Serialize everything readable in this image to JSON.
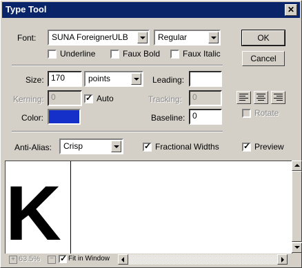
{
  "window": {
    "title": "Type Tool"
  },
  "font": {
    "label": "Font:",
    "family": "SUNA ForeignerULB",
    "style": "Regular"
  },
  "options": {
    "underline": "Underline",
    "faux_bold": "Faux Bold",
    "faux_italic": "Faux Italic"
  },
  "buttons": {
    "ok": "OK",
    "cancel": "Cancel"
  },
  "size": {
    "label": "Size:",
    "value": "170",
    "unit": "points"
  },
  "leading": {
    "label": "Leading:",
    "value": ""
  },
  "kerning": {
    "label": "Kerning:",
    "value": "0",
    "auto_label": "Auto",
    "auto_checked": true
  },
  "tracking": {
    "label": "Tracking:",
    "value": "0"
  },
  "color": {
    "label": "Color:",
    "swatch": "#1530c8"
  },
  "baseline": {
    "label": "Baseline:",
    "value": "0"
  },
  "rotate": {
    "label": "Rotate"
  },
  "antialias": {
    "label": "Anti-Alias:",
    "value": "Crisp"
  },
  "fractional": {
    "label": "Fractional Widths",
    "checked": true
  },
  "preview_opt": {
    "label": "Preview",
    "checked": true
  },
  "preview_text": "K",
  "status": {
    "zoom": "63.5%",
    "fit_label": "Fit in Window"
  },
  "alignment_icons": [
    "align-left-icon",
    "align-center-icon",
    "align-right-icon"
  ]
}
